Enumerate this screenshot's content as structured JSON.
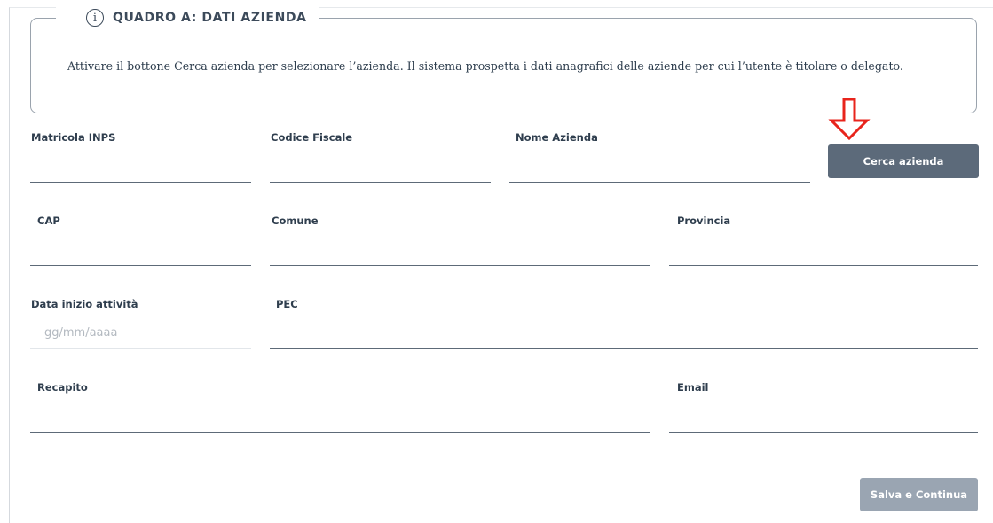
{
  "section": {
    "title": "QUADRO A: DATI AZIENDA",
    "info_icon_glyph": "i",
    "info_text": "Attivare il bottone Cerca azienda per selezionare l’azienda. Il sistema prospetta i dati anagrafici delle aziende per cui l’utente è titolare o delegato."
  },
  "fields": {
    "matricola_inps": {
      "label": "Matricola INPS",
      "value": ""
    },
    "codice_fiscale": {
      "label": "Codice Fiscale",
      "value": ""
    },
    "nome_azienda": {
      "label": "Nome Azienda",
      "value": ""
    },
    "cap": {
      "label": "CAP",
      "value": ""
    },
    "comune": {
      "label": "Comune",
      "value": ""
    },
    "provincia": {
      "label": "Provincia",
      "value": ""
    },
    "data_inizio": {
      "label": "Data inizio attività",
      "placeholder": "gg/mm/aaaa"
    },
    "pec": {
      "label": "PEC",
      "value": ""
    },
    "recapito": {
      "label": "Recapito",
      "value": ""
    },
    "email": {
      "label": "Email",
      "value": ""
    }
  },
  "buttons": {
    "search": "Cerca azienda",
    "save": "Salva e Continua"
  },
  "annotation": {
    "icon": "down-arrow-icon",
    "color": "#e8241c"
  },
  "colors": {
    "primary_button": "#5c6a7a",
    "disabled_button": "#9aa5b2",
    "border": "#9aa3ad"
  }
}
